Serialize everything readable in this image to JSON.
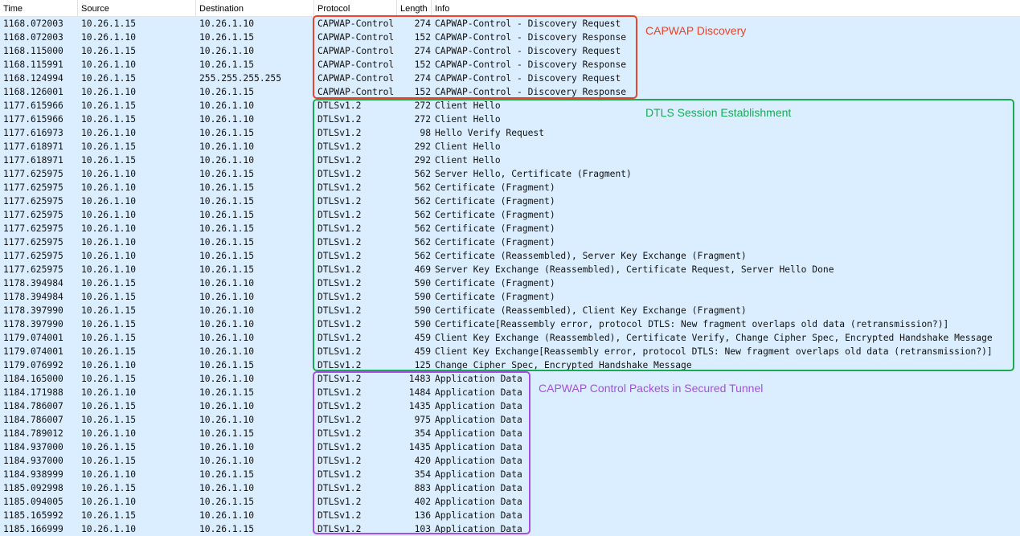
{
  "columns": {
    "time": "Time",
    "source": "Source",
    "destination": "Destination",
    "protocol": "Protocol",
    "length": "Length",
    "info": "Info"
  },
  "packets": [
    {
      "time": "1168.072003",
      "src": "10.26.1.15",
      "dst": "10.26.1.10",
      "proto": "CAPWAP-Control",
      "len": "274",
      "info": "CAPWAP-Control - Discovery Request"
    },
    {
      "time": "1168.072003",
      "src": "10.26.1.10",
      "dst": "10.26.1.15",
      "proto": "CAPWAP-Control",
      "len": "152",
      "info": "CAPWAP-Control - Discovery Response"
    },
    {
      "time": "1168.115000",
      "src": "10.26.1.15",
      "dst": "10.26.1.10",
      "proto": "CAPWAP-Control",
      "len": "274",
      "info": "CAPWAP-Control - Discovery Request"
    },
    {
      "time": "1168.115991",
      "src": "10.26.1.10",
      "dst": "10.26.1.15",
      "proto": "CAPWAP-Control",
      "len": "152",
      "info": "CAPWAP-Control - Discovery Response"
    },
    {
      "time": "1168.124994",
      "src": "10.26.1.15",
      "dst": "255.255.255.255",
      "proto": "CAPWAP-Control",
      "len": "274",
      "info": "CAPWAP-Control - Discovery Request"
    },
    {
      "time": "1168.126001",
      "src": "10.26.1.10",
      "dst": "10.26.1.15",
      "proto": "CAPWAP-Control",
      "len": "152",
      "info": "CAPWAP-Control - Discovery Response"
    },
    {
      "time": "1177.615966",
      "src": "10.26.1.15",
      "dst": "10.26.1.10",
      "proto": "DTLSv1.2",
      "len": "272",
      "info": "Client Hello"
    },
    {
      "time": "1177.615966",
      "src": "10.26.1.15",
      "dst": "10.26.1.10",
      "proto": "DTLSv1.2",
      "len": "272",
      "info": "Client Hello"
    },
    {
      "time": "1177.616973",
      "src": "10.26.1.10",
      "dst": "10.26.1.15",
      "proto": "DTLSv1.2",
      "len": "98",
      "info": "Hello Verify Request"
    },
    {
      "time": "1177.618971",
      "src": "10.26.1.15",
      "dst": "10.26.1.10",
      "proto": "DTLSv1.2",
      "len": "292",
      "info": "Client Hello"
    },
    {
      "time": "1177.618971",
      "src": "10.26.1.15",
      "dst": "10.26.1.10",
      "proto": "DTLSv1.2",
      "len": "292",
      "info": "Client Hello"
    },
    {
      "time": "1177.625975",
      "src": "10.26.1.10",
      "dst": "10.26.1.15",
      "proto": "DTLSv1.2",
      "len": "562",
      "info": "Server Hello, Certificate (Fragment)"
    },
    {
      "time": "1177.625975",
      "src": "10.26.1.10",
      "dst": "10.26.1.15",
      "proto": "DTLSv1.2",
      "len": "562",
      "info": "Certificate (Fragment)"
    },
    {
      "time": "1177.625975",
      "src": "10.26.1.10",
      "dst": "10.26.1.15",
      "proto": "DTLSv1.2",
      "len": "562",
      "info": "Certificate (Fragment)"
    },
    {
      "time": "1177.625975",
      "src": "10.26.1.10",
      "dst": "10.26.1.15",
      "proto": "DTLSv1.2",
      "len": "562",
      "info": "Certificate (Fragment)"
    },
    {
      "time": "1177.625975",
      "src": "10.26.1.10",
      "dst": "10.26.1.15",
      "proto": "DTLSv1.2",
      "len": "562",
      "info": "Certificate (Fragment)"
    },
    {
      "time": "1177.625975",
      "src": "10.26.1.10",
      "dst": "10.26.1.15",
      "proto": "DTLSv1.2",
      "len": "562",
      "info": "Certificate (Fragment)"
    },
    {
      "time": "1177.625975",
      "src": "10.26.1.10",
      "dst": "10.26.1.15",
      "proto": "DTLSv1.2",
      "len": "562",
      "info": "Certificate (Reassembled), Server Key Exchange (Fragment)"
    },
    {
      "time": "1177.625975",
      "src": "10.26.1.10",
      "dst": "10.26.1.15",
      "proto": "DTLSv1.2",
      "len": "469",
      "info": "Server Key Exchange (Reassembled), Certificate Request, Server Hello Done"
    },
    {
      "time": "1178.394984",
      "src": "10.26.1.15",
      "dst": "10.26.1.10",
      "proto": "DTLSv1.2",
      "len": "590",
      "info": "Certificate (Fragment)"
    },
    {
      "time": "1178.394984",
      "src": "10.26.1.15",
      "dst": "10.26.1.10",
      "proto": "DTLSv1.2",
      "len": "590",
      "info": "Certificate (Fragment)"
    },
    {
      "time": "1178.397990",
      "src": "10.26.1.15",
      "dst": "10.26.1.10",
      "proto": "DTLSv1.2",
      "len": "590",
      "info": "Certificate (Reassembled), Client Key Exchange (Fragment)"
    },
    {
      "time": "1178.397990",
      "src": "10.26.1.15",
      "dst": "10.26.1.10",
      "proto": "DTLSv1.2",
      "len": "590",
      "info": "Certificate[Reassembly error, protocol DTLS: New fragment overlaps old data (retransmission?)]"
    },
    {
      "time": "1179.074001",
      "src": "10.26.1.15",
      "dst": "10.26.1.10",
      "proto": "DTLSv1.2",
      "len": "459",
      "info": "Client Key Exchange (Reassembled), Certificate Verify, Change Cipher Spec, Encrypted Handshake Message"
    },
    {
      "time": "1179.074001",
      "src": "10.26.1.15",
      "dst": "10.26.1.10",
      "proto": "DTLSv1.2",
      "len": "459",
      "info": "Client Key Exchange[Reassembly error, protocol DTLS: New fragment overlaps old data (retransmission?)]"
    },
    {
      "time": "1179.076992",
      "src": "10.26.1.10",
      "dst": "10.26.1.15",
      "proto": "DTLSv1.2",
      "len": "125",
      "info": "Change Cipher Spec, Encrypted Handshake Message"
    },
    {
      "time": "1184.165000",
      "src": "10.26.1.15",
      "dst": "10.26.1.10",
      "proto": "DTLSv1.2",
      "len": "1483",
      "info": "Application Data"
    },
    {
      "time": "1184.171988",
      "src": "10.26.1.10",
      "dst": "10.26.1.15",
      "proto": "DTLSv1.2",
      "len": "1484",
      "info": "Application Data"
    },
    {
      "time": "1184.786007",
      "src": "10.26.1.15",
      "dst": "10.26.1.10",
      "proto": "DTLSv1.2",
      "len": "1435",
      "info": "Application Data"
    },
    {
      "time": "1184.786007",
      "src": "10.26.1.15",
      "dst": "10.26.1.10",
      "proto": "DTLSv1.2",
      "len": "975",
      "info": "Application Data"
    },
    {
      "time": "1184.789012",
      "src": "10.26.1.10",
      "dst": "10.26.1.15",
      "proto": "DTLSv1.2",
      "len": "354",
      "info": "Application Data"
    },
    {
      "time": "1184.937000",
      "src": "10.26.1.15",
      "dst": "10.26.1.10",
      "proto": "DTLSv1.2",
      "len": "1435",
      "info": "Application Data"
    },
    {
      "time": "1184.937000",
      "src": "10.26.1.15",
      "dst": "10.26.1.10",
      "proto": "DTLSv1.2",
      "len": "420",
      "info": "Application Data"
    },
    {
      "time": "1184.938999",
      "src": "10.26.1.10",
      "dst": "10.26.1.15",
      "proto": "DTLSv1.2",
      "len": "354",
      "info": "Application Data"
    },
    {
      "time": "1185.092998",
      "src": "10.26.1.15",
      "dst": "10.26.1.10",
      "proto": "DTLSv1.2",
      "len": "883",
      "info": "Application Data"
    },
    {
      "time": "1185.094005",
      "src": "10.26.1.10",
      "dst": "10.26.1.15",
      "proto": "DTLSv1.2",
      "len": "402",
      "info": "Application Data"
    },
    {
      "time": "1185.165992",
      "src": "10.26.1.15",
      "dst": "10.26.1.10",
      "proto": "DTLSv1.2",
      "len": "136",
      "info": "Application Data"
    },
    {
      "time": "1185.166999",
      "src": "10.26.1.10",
      "dst": "10.26.1.15",
      "proto": "DTLSv1.2",
      "len": "103",
      "info": "Application Data"
    }
  ],
  "annotations": {
    "discovery": {
      "label": "CAPWAP Discovery",
      "color": "#e8452c"
    },
    "dtls": {
      "label": "DTLS Session Establishment",
      "color": "#1aaa55"
    },
    "tunnel": {
      "label": "CAPWAP Control Packets in Secured Tunnel",
      "color": "#a64fe0"
    }
  },
  "colors": {
    "row_background": "#daeeff"
  }
}
